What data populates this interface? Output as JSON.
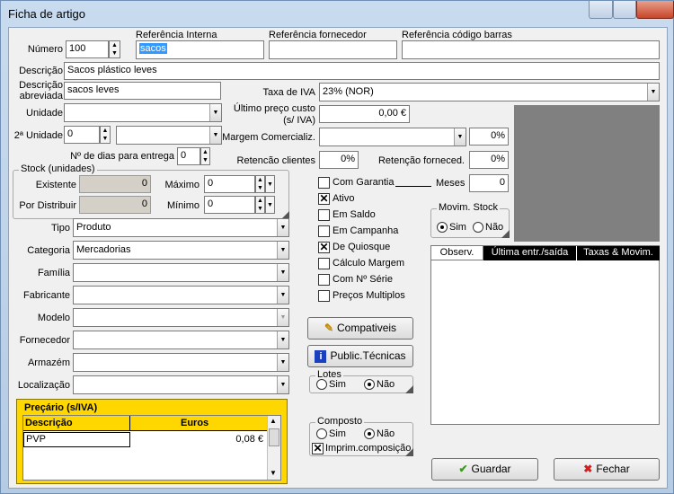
{
  "window": {
    "title": "Ficha de artigo"
  },
  "ref": {
    "interna_label": "Referência Interna",
    "interna_value": "sacos",
    "fornecedor_label": "Referência fornecedor",
    "codigo_barras_label": "Referência código barras"
  },
  "numero": {
    "label": "Número",
    "value": "100"
  },
  "descricao": {
    "label": "Descrição",
    "value": "Sacos plástico leves"
  },
  "descricao_abreviada": {
    "label_line1": "Descrição",
    "label_line2": "abreviada",
    "value": "sacos leves"
  },
  "unidade": {
    "label": "Unidade",
    "value": ""
  },
  "segunda_unidade": {
    "label": "2ª Unidade",
    "value": "0"
  },
  "dias_entrega": {
    "label": "Nº de dias para entrega",
    "value": "0"
  },
  "taxa_iva": {
    "label": "Taxa de IVA",
    "value": "23% (NOR)"
  },
  "ultimo_preco": {
    "label_line1": "Último preço custo",
    "label_line2": "(s/ IVA)",
    "value": "0,00 €"
  },
  "margem": {
    "label": "Margem Comercializ.",
    "value": "",
    "pct": "0%"
  },
  "retencao_clientes": {
    "label": "Retencão clientes",
    "value": "0%"
  },
  "retencao_fornec": {
    "label": "Retenção forneced.",
    "value": "0%"
  },
  "stock": {
    "title": "Stock (unidades)",
    "existente_label": "Existente",
    "existente_value": "0",
    "distribuir_label": "Por Distribuir",
    "distribuir_value": "0",
    "maximo_label": "Máximo",
    "maximo_value": "0",
    "minimo_label": "Mínimo",
    "minimo_value": "0"
  },
  "fields": [
    {
      "label": "Tipo",
      "value": "Produto"
    },
    {
      "label": "Categoria",
      "value": "Mercadorias"
    },
    {
      "label": "Família",
      "value": ""
    },
    {
      "label": "Fabricante",
      "value": ""
    },
    {
      "label": "Modelo",
      "value": ""
    },
    {
      "label": "Fornecedor",
      "value": ""
    },
    {
      "label": "Armazém",
      "value": ""
    },
    {
      "label": "Localização",
      "value": ""
    }
  ],
  "options": {
    "com_garantia": {
      "label": "Com Garantia",
      "checked": false
    },
    "meses_label": "Meses",
    "meses_value": "0",
    "ativo": {
      "label": "Ativo",
      "checked": true
    },
    "em_saldo": {
      "label": "Em Saldo",
      "checked": false
    },
    "em_campanha": {
      "label": "Em Campanha",
      "checked": false
    },
    "de_quiosque": {
      "label": "De Quiosque",
      "checked": true
    },
    "calculo_margem": {
      "label": "Cálculo Margem",
      "checked": false
    },
    "com_serie": {
      "label": "Com Nº Série",
      "checked": false
    },
    "precos_multiplos": {
      "label": "Preços Multiplos",
      "checked": false
    }
  },
  "movim_stock": {
    "title": "Movim. Stock",
    "sim": "Sim",
    "nao": "Não",
    "selected": "sim"
  },
  "tabs": [
    "Observ.",
    "Última entr./saída",
    "Taxas & Movim."
  ],
  "buttons": {
    "compativeis": "Compativeis",
    "public_tecnicas": "Public.Técnicas",
    "guardar": "Guardar",
    "fechar": "Fechar"
  },
  "lotes": {
    "title": "Lotes",
    "sim": "Sim",
    "nao": "Não",
    "selected": "nao"
  },
  "composto": {
    "title": "Composto",
    "sim": "Sim",
    "nao": "Não",
    "selected": "nao",
    "imprim": "Imprim.composição",
    "imprim_checked": true
  },
  "precario": {
    "title": "Preçário (s/IVA)",
    "col_descricao": "Descrição",
    "col_euros": "Euros",
    "rows": [
      {
        "descricao": "PVP",
        "euros": "0,08 €"
      }
    ]
  },
  "colors": {
    "accent_yellow": "#ffd700",
    "selection_blue": "#3399ff",
    "photo_gray": "#808080"
  }
}
